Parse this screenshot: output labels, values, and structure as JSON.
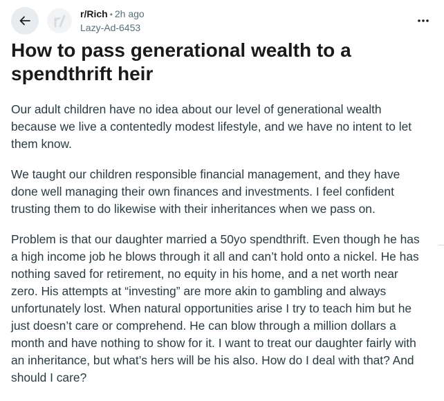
{
  "post": {
    "subreddit": "r/Rich",
    "separator": "•",
    "time": "2h ago",
    "author": "Lazy-Ad-6453",
    "title": "How to pass generational wealth to a spendthrift heir",
    "paragraphs": [
      "Our adult children have no idea about our level of generational wealth because we live a contentedly modest lifestyle, and we have no intent to let them know.",
      "We taught our children responsible financial management, and they have done well managing their own finances and investments. I feel confident trusting them to do likewise with their inheritances when we pass on.",
      "Problem is that our daughter married a 50yo spendthrift. Even though he has a high income job he blows through it all and can’t hold onto a nickel. He has nothing saved for retirement, no equity in his home, and a net worth near zero. His attempts at “investing” are more akin to gambling and always unfortunately lost. When natural opportunities arise I try to teach him but he just doesn’t care or comprehend. He can blow through a million dollars a month and have nothing to show for it. I want to treat our daughter fairly with an inheritance, but what’s hers will be his also. How do I deal with that? And should I care?"
    ]
  },
  "icons": {
    "back": "arrow-left-icon",
    "subreddit_avatar": "subreddit-avatar-icon",
    "more": "more-horizontal-icon"
  },
  "colors": {
    "text": "#1c1c1c",
    "muted": "#576f76",
    "back_bg": "#e9ecef"
  }
}
